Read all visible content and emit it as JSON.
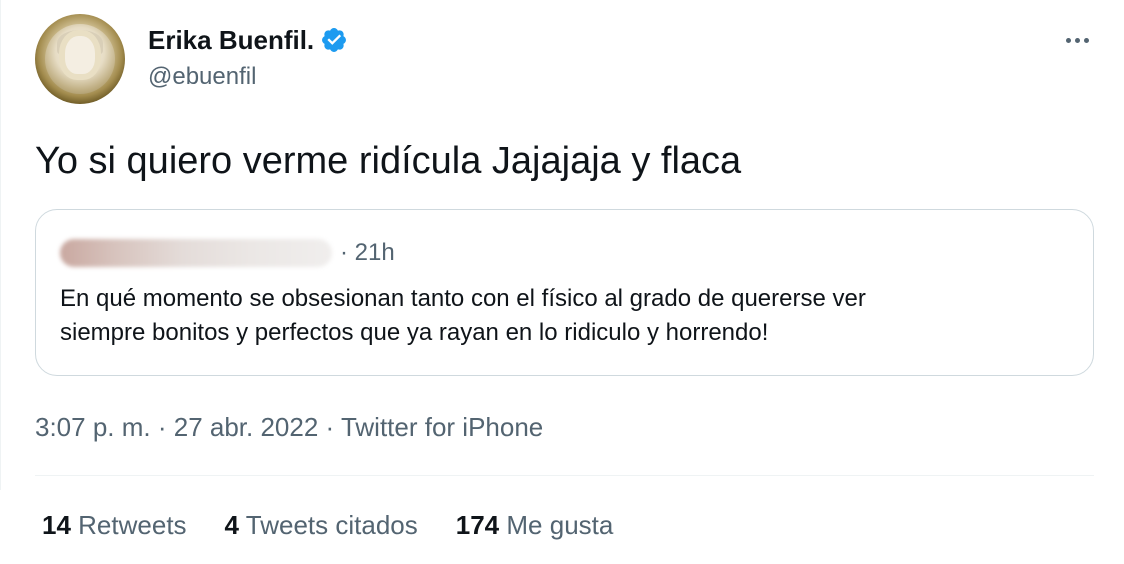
{
  "author": {
    "display_name": "Erika Buenfil.",
    "handle": "@ebuenfil",
    "verified": true
  },
  "tweet": {
    "text": "Yo si quiero verme ridícula Jajajaja y flaca"
  },
  "quoted_tweet": {
    "time": "· 21h",
    "lines": [
      "En qué momento se obsesionan tanto con el físico al grado de quererse ver",
      "siempre bonitos y perfectos que ya rayan en lo ridiculo y horrendo!"
    ]
  },
  "meta": {
    "time": "3:07 p. m.",
    "sep1": " · ",
    "date": "27 abr. 2022",
    "sep2": " · ",
    "source": "Twitter for iPhone"
  },
  "stats": [
    {
      "count": "14",
      "label": "Retweets"
    },
    {
      "count": "4",
      "label": "Tweets citados"
    },
    {
      "count": "174",
      "label": "Me gusta"
    }
  ],
  "colors": {
    "verified_badge": "#1d9bf0",
    "secondary_text": "#536471",
    "border": "#cfd9de"
  },
  "icons": {
    "verified": "verified-badge-icon",
    "more": "more-options-icon"
  }
}
